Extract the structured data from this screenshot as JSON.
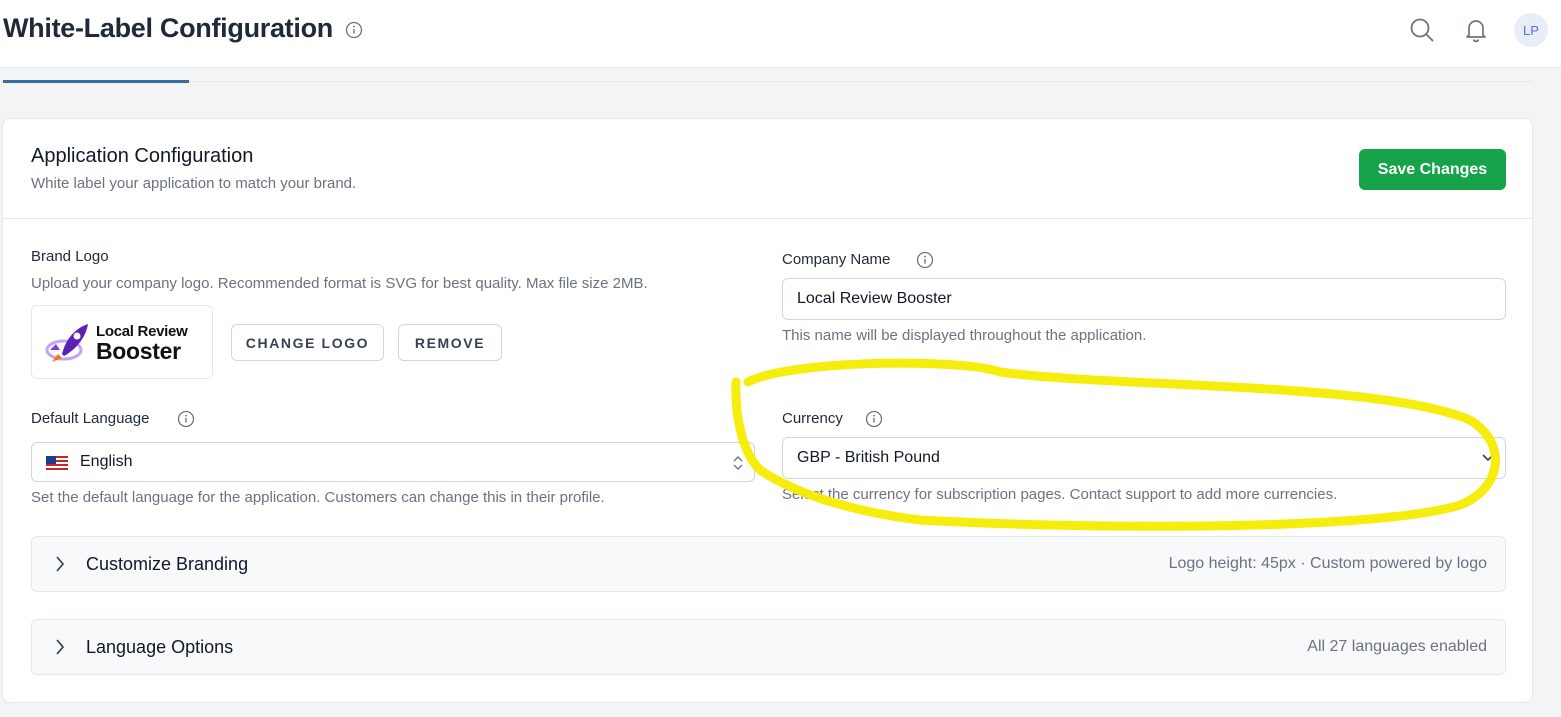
{
  "header": {
    "title": "White-Label Configuration",
    "avatar_initials": "LP"
  },
  "card": {
    "title": "Application Configuration",
    "subtitle": "White label your application to match your brand.",
    "save_label": "Save Changes"
  },
  "brand_logo": {
    "label": "Brand Logo",
    "help": "Upload your company logo. Recommended format is SVG for best quality. Max file size 2MB.",
    "logo_line1": "Local Review",
    "logo_line2": "Booster",
    "change_label": "CHANGE LOGO",
    "remove_label": "REMOVE"
  },
  "company_name": {
    "label": "Company Name",
    "value": "Local Review Booster",
    "help": "This name will be displayed throughout the application."
  },
  "default_language": {
    "label": "Default Language",
    "value": "English",
    "help": "Set the default language for the application. Customers can change this in their profile."
  },
  "currency": {
    "label": "Currency",
    "value": "GBP - British Pound",
    "help": "Select the currency for subscription pages. Contact support to add more currencies."
  },
  "accordions": [
    {
      "title": "Customize Branding",
      "meta": "Logo height: 45px · Custom powered by logo"
    },
    {
      "title": "Language Options",
      "meta": "All 27 languages enabled"
    }
  ],
  "colors": {
    "primary_button": "#16a34a",
    "tab_indicator": "#3b6aa0",
    "annotation": "#f5ec00"
  },
  "icons": [
    "info-icon",
    "search-icon",
    "bell-icon",
    "us-flag-icon",
    "updown-chevron-icon",
    "chevron-down-icon",
    "chevron-right-icon"
  ]
}
